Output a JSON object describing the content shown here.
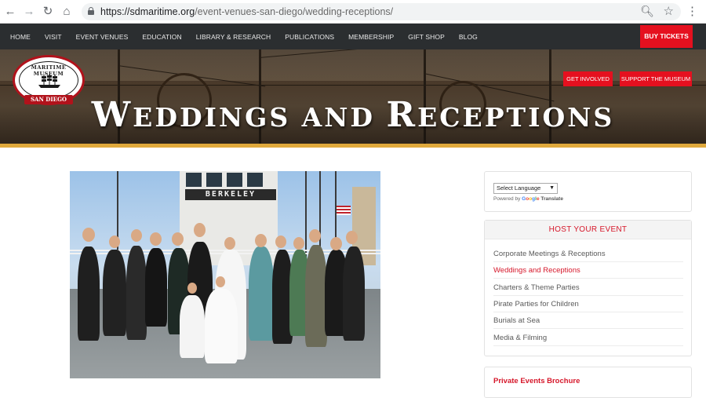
{
  "browser": {
    "url_host": "https://sdmaritime.org",
    "url_path": "/event-venues-san-diego/wedding-receptions/"
  },
  "nav": {
    "items": [
      "HOME",
      "VISIT",
      "EVENT VENUES",
      "EDUCATION",
      "LIBRARY & RESEARCH",
      "PUBLICATIONS",
      "MEMBERSHIP",
      "GIFT SHOP",
      "BLOG"
    ],
    "buy_tickets": "BUY TICKETS"
  },
  "hero": {
    "title_w": "W",
    "title_rest1": "EDDINGS AND ",
    "title_r": "R",
    "title_rest2": "ECEPTIONS",
    "get_involved": "GET INVOLVED",
    "support": "SUPPORT THE MUSEUM"
  },
  "logo": {
    "ring_text": "MARITIME MUSEUM",
    "banner": "SAN DIEGO"
  },
  "photo": {
    "ship_sign": "BERKELEY"
  },
  "translate": {
    "select_label": "Select Language",
    "powered_by": "Powered by",
    "google": "Google",
    "translate": "Translate"
  },
  "host_event": {
    "heading": "HOST YOUR EVENT",
    "links": [
      "Corporate Meetings & Receptions",
      "Weddings and Receptions",
      "Charters & Theme Parties",
      "Pirate Parties for Children",
      "Burials at Sea",
      "Media & Filming"
    ],
    "active_index": 1
  },
  "brochure": {
    "label": "Private Events Brochure"
  },
  "colors": {
    "brand_red": "#e5101f",
    "nav_bg": "#2b2e30",
    "accent_gold": "#e0a93c",
    "link_red": "#d6172a"
  }
}
